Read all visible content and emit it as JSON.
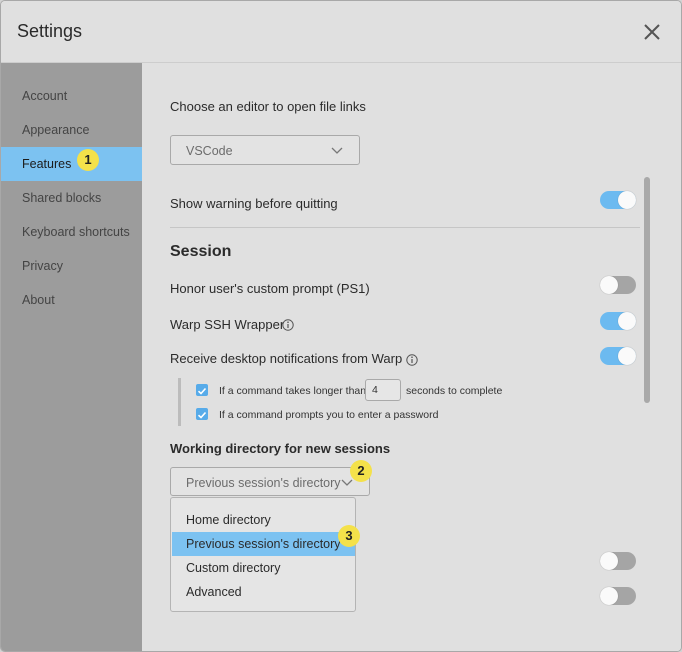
{
  "window": {
    "title": "Settings"
  },
  "sidebar": {
    "items": [
      {
        "label": "Account"
      },
      {
        "label": "Appearance"
      },
      {
        "label": "Features",
        "active": true
      },
      {
        "label": "Shared blocks"
      },
      {
        "label": "Keyboard shortcuts"
      },
      {
        "label": "Privacy"
      },
      {
        "label": "About"
      }
    ]
  },
  "features": {
    "editor_label": "Choose an editor to open file links",
    "editor_value": "VSCode",
    "warn_quit_label": "Show warning before quitting",
    "warn_quit_on": true,
    "session_heading": "Session",
    "ps1_label": "Honor user's custom prompt (PS1)",
    "ps1_on": false,
    "ssh_label": "Warp SSH Wrapper",
    "ssh_on": true,
    "notif_label": "Receive desktop notifications from Warp",
    "notif_on": true,
    "long_cmd_prefix": "If a command takes longer than",
    "long_cmd_value": "4",
    "long_cmd_suffix": "seconds to complete",
    "password_label": "If a command prompts you to enter a password",
    "workdir_heading": "Working directory for new sessions",
    "workdir_value": "Previous session's directory",
    "workdir_options": [
      {
        "label": "Home directory"
      },
      {
        "label": "Previous session's directory",
        "selected": true
      },
      {
        "label": "Custom directory"
      },
      {
        "label": "Advanced"
      }
    ],
    "hidden_toggle_1_on": false,
    "hidden_toggle_2_on": false
  },
  "annotations": {
    "badge1": "1",
    "badge2": "2",
    "badge3": "3"
  },
  "colors": {
    "accent": "#7cc2f1",
    "toggle_on": "#6cbaf0",
    "badge": "#f4e14a"
  }
}
